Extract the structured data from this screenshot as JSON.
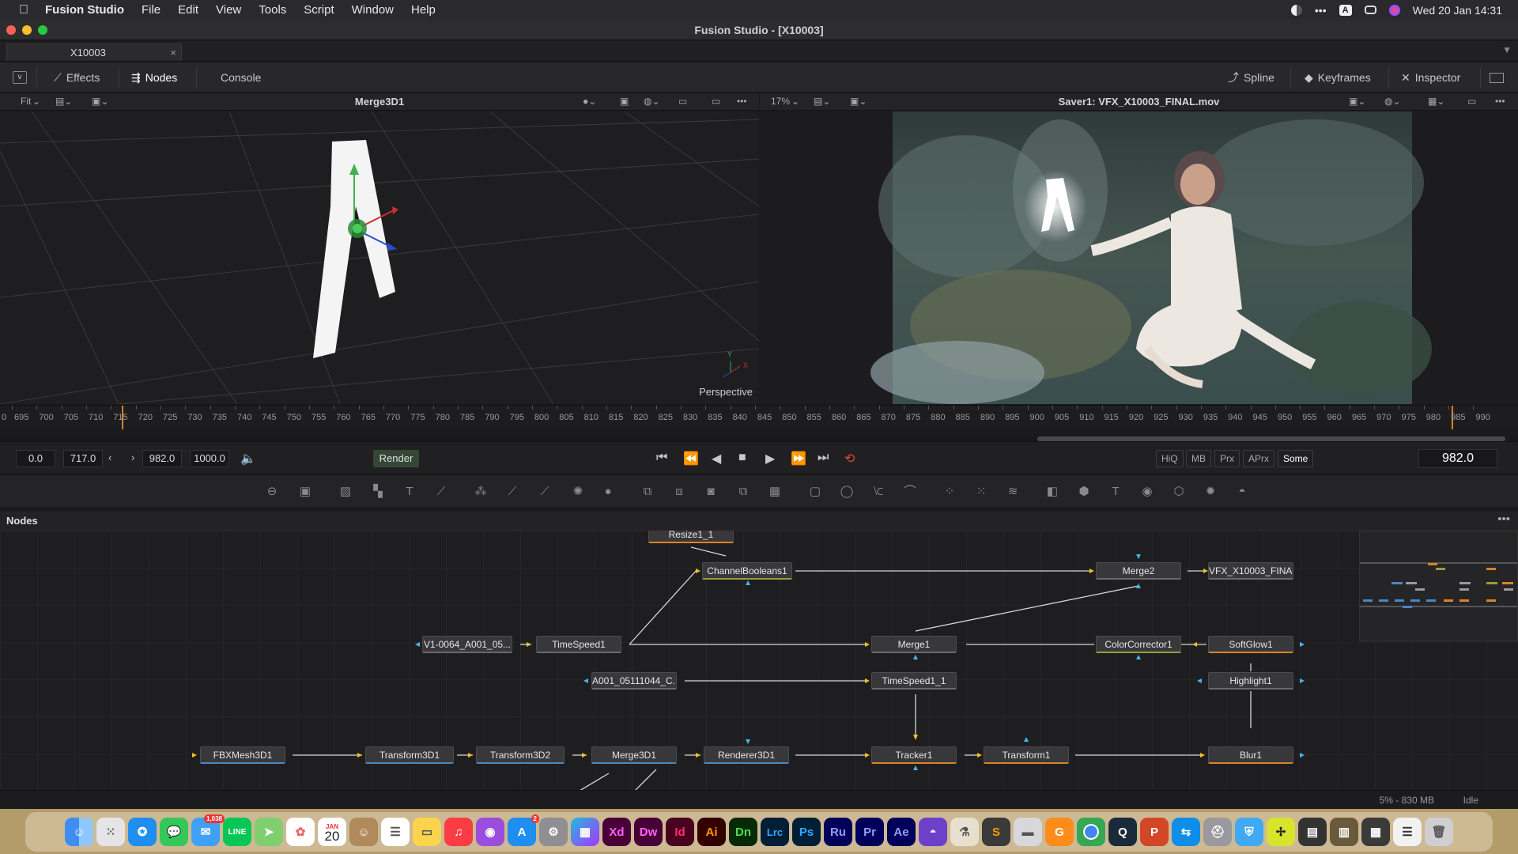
{
  "menubar": {
    "app": "Fusion Studio",
    "items": [
      "File",
      "Edit",
      "View",
      "Tools",
      "Script",
      "Window",
      "Help"
    ],
    "clock": "Wed 20 Jan  14:31"
  },
  "window": {
    "title": "Fusion Studio - [X10003]"
  },
  "doc_tab": {
    "label": "X10003"
  },
  "toolbar": {
    "effects": "Effects",
    "nodes": "Nodes",
    "console": "Console",
    "spline": "Spline",
    "keyframes": "Keyframes",
    "inspector": "Inspector"
  },
  "left_viewer": {
    "fit": "Fit",
    "title": "Merge3D1",
    "perspective": "Perspective",
    "axis_y": "Y",
    "axis_x": "X"
  },
  "right_viewer": {
    "zoom": "17%",
    "title": "Saver1: VFX_X10003_FINAL.mov"
  },
  "ruler": {
    "ticks": [
      "695",
      "700",
      "705",
      "710",
      "715",
      "720",
      "725",
      "730",
      "735",
      "740",
      "745",
      "750",
      "755",
      "760",
      "765",
      "770",
      "775",
      "780",
      "785",
      "790",
      "795",
      "800",
      "805",
      "810",
      "815",
      "820",
      "825",
      "830",
      "835",
      "840",
      "845",
      "850",
      "855",
      "860",
      "865",
      "870",
      "875",
      "880",
      "885",
      "890",
      "895",
      "900",
      "905",
      "910",
      "915",
      "920",
      "925",
      "930",
      "935",
      "940",
      "945",
      "950",
      "955",
      "960",
      "965",
      "970",
      "975",
      "980",
      "985",
      "990"
    ]
  },
  "transport": {
    "global_start": "0.0",
    "render_start": "717.0",
    "render_end": "982.0",
    "global_end": "1000.0",
    "render_label": "Render",
    "hiq": "HiQ",
    "mb": "MB",
    "prx": "Prx",
    "aprx": "APrx",
    "some": "Some",
    "current_frame": "982.0"
  },
  "nodes_panel": {
    "title": "Nodes",
    "nodes": [
      {
        "id": "resize",
        "label": "Resize1_1"
      },
      {
        "id": "channelbooleans",
        "label": "ChannelBooleans1"
      },
      {
        "id": "merge2",
        "label": "Merge2"
      },
      {
        "id": "saver",
        "label": "VFX_X10003_FINA..."
      },
      {
        "id": "loader1",
        "label": "V1-0064_A001_05..."
      },
      {
        "id": "timespeed1",
        "label": "TimeSpeed1"
      },
      {
        "id": "merge1",
        "label": "Merge1"
      },
      {
        "id": "colorcorrector",
        "label": "ColorCorrector1"
      },
      {
        "id": "softglow",
        "label": "SoftGlow1"
      },
      {
        "id": "loader2",
        "label": "A001_05111044_C..."
      },
      {
        "id": "timespeed1_1",
        "label": "TimeSpeed1_1"
      },
      {
        "id": "highlight",
        "label": "Highlight1"
      },
      {
        "id": "fbxmesh",
        "label": "FBXMesh3D1"
      },
      {
        "id": "transform3d1",
        "label": "Transform3D1"
      },
      {
        "id": "transform3d2",
        "label": "Transform3D2"
      },
      {
        "id": "merge3d",
        "label": "Merge3D1"
      },
      {
        "id": "renderer3d",
        "label": "Renderer3D1"
      },
      {
        "id": "tracker",
        "label": "Tracker1"
      },
      {
        "id": "transform1",
        "label": "Transform1"
      },
      {
        "id": "blur",
        "label": "Blur1"
      }
    ]
  },
  "status": {
    "memory": "5% - 830 MB",
    "state": "Idle"
  },
  "dock": {
    "mail_badge": "1,038",
    "calendar_month": "JAN",
    "calendar_day": "20",
    "appstore_badge": "2",
    "labels": [
      "Xd",
      "Dw",
      "Id",
      "Ai",
      "Dn",
      "Lrc",
      "Ps",
      "Ru",
      "Pr",
      "Ae"
    ]
  },
  "colors": {
    "accent_orange": "#d9822b",
    "accent_blue": "#4a86c4",
    "render_green": "#364636"
  }
}
